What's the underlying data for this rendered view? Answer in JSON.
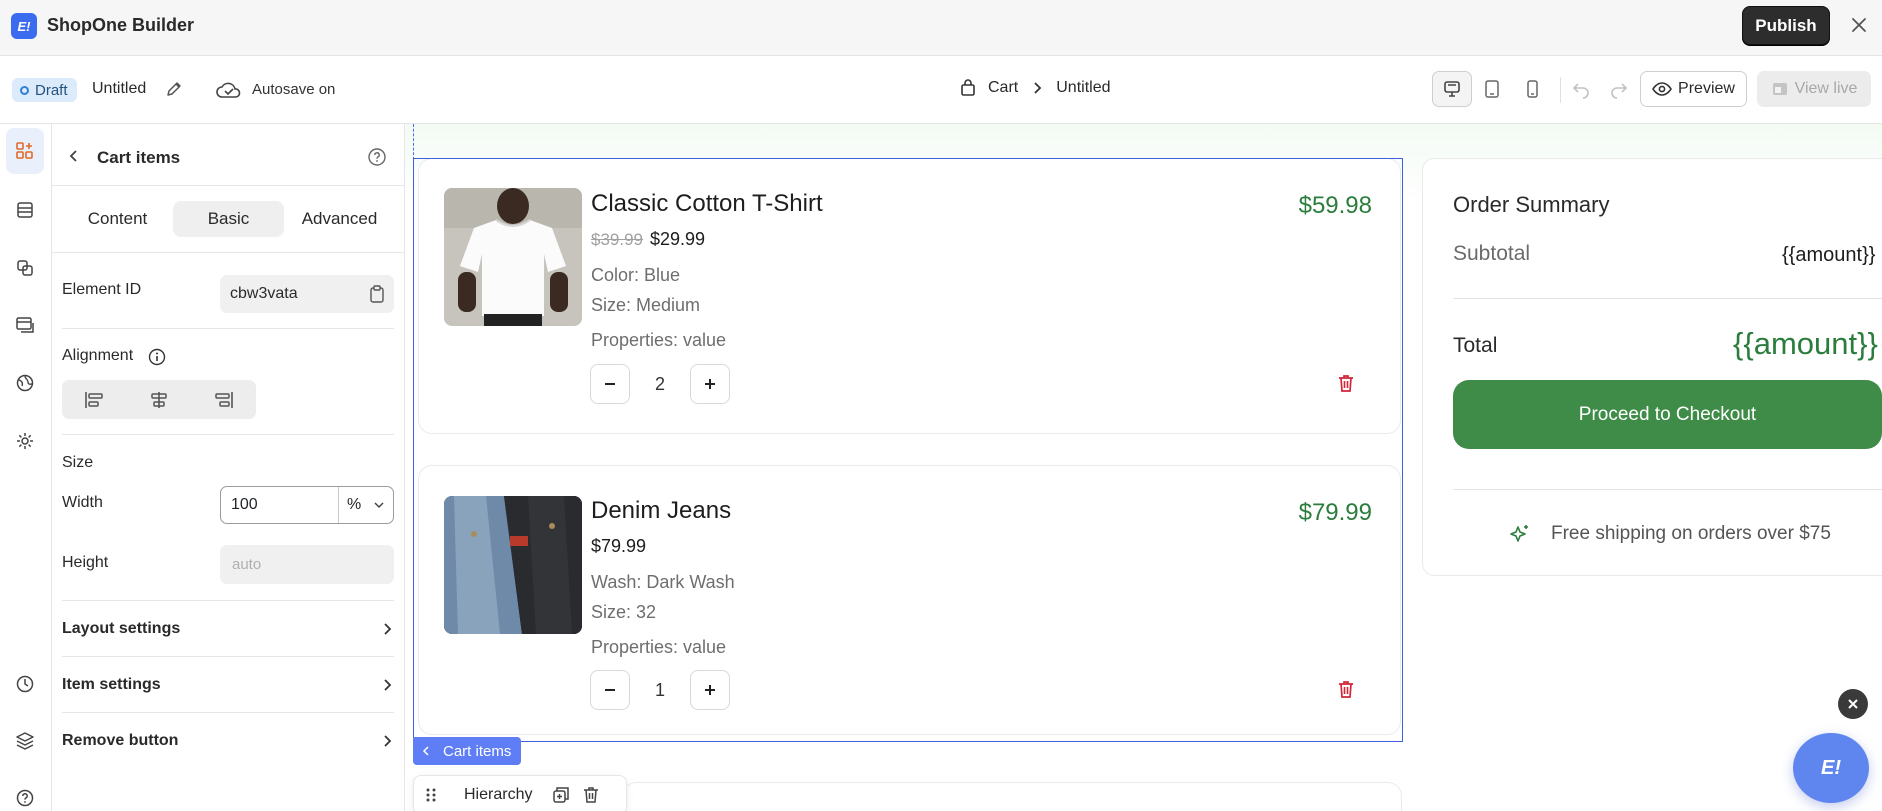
{
  "app": {
    "logo_text": "E!",
    "name": "ShopOne Builder",
    "publish_label": "Publish"
  },
  "toolbar": {
    "status_badge": "Draft",
    "doc_title": "Untitled",
    "autosave_label": "Autosave on",
    "breadcrumb": {
      "root": "Cart",
      "current": "Untitled"
    },
    "preview_label": "Preview",
    "view_live_label": "View live",
    "devices": [
      "desktop",
      "tablet",
      "mobile"
    ],
    "active_device": "desktop"
  },
  "panel": {
    "title": "Cart items",
    "tabs": [
      "Content",
      "Basic",
      "Advanced"
    ],
    "active_tab": "Basic",
    "element_id_label": "Element ID",
    "element_id_value": "cbw3vata",
    "alignment_label": "Alignment",
    "size_label": "Size",
    "width_label": "Width",
    "width_value": "100",
    "width_unit": "%",
    "height_label": "Height",
    "height_placeholder": "auto",
    "sections": [
      "Layout settings",
      "Item settings",
      "Remove button"
    ]
  },
  "cart": {
    "items": [
      {
        "name": "Classic Cotton T-Shirt",
        "old_price": "$39.99",
        "price": "$29.99",
        "attr1": "Color: Blue",
        "attr2": "Size: Medium",
        "props": "Properties: value",
        "qty": "2",
        "total": "$59.98"
      },
      {
        "name": "Denim Jeans",
        "old_price": "",
        "price": "$79.99",
        "attr1": "Wash: Dark Wash",
        "attr2": "Size: 32",
        "props": "Properties: value",
        "qty": "1",
        "total": "$79.99"
      }
    ],
    "tag_label": "Cart items",
    "hierarchy_label": "Hierarchy"
  },
  "summary": {
    "title": "Order Summary",
    "subtotal_label": "Subtotal",
    "subtotal_value": "{{amount}}",
    "total_label": "Total",
    "total_value": "{{amount}}",
    "checkout_label": "Proceed to Checkout",
    "shipping_text": "Free shipping on orders over $75"
  },
  "colors": {
    "accent": "#3b6cf0",
    "price_green": "#2b7d3d",
    "checkout": "#3f8c48",
    "selection": "#3f5fe0",
    "trash": "#d2263a"
  }
}
